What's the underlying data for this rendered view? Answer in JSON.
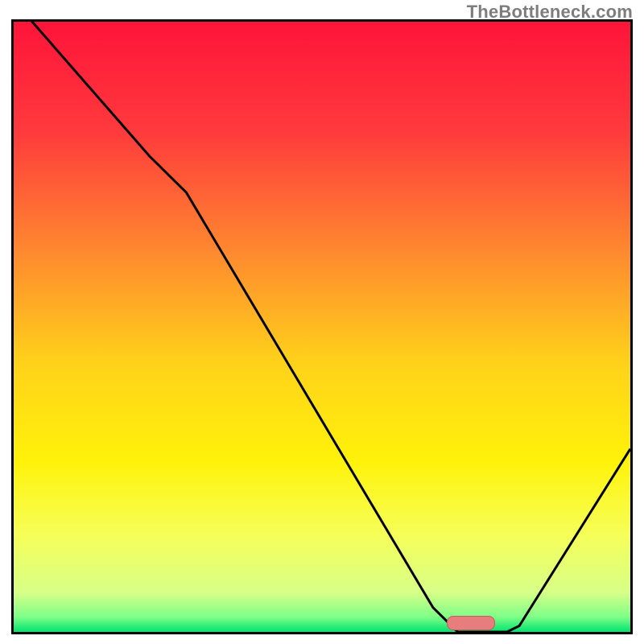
{
  "watermark": "TheBottleneck.com",
  "colors": {
    "gradient_stops": [
      {
        "offset": 0,
        "color": "#ff143a"
      },
      {
        "offset": 0.18,
        "color": "#ff3a3c"
      },
      {
        "offset": 0.38,
        "color": "#ff8a2f"
      },
      {
        "offset": 0.56,
        "color": "#ffd21a"
      },
      {
        "offset": 0.72,
        "color": "#fff20a"
      },
      {
        "offset": 0.84,
        "color": "#f6ff58"
      },
      {
        "offset": 0.935,
        "color": "#d8ff88"
      },
      {
        "offset": 0.975,
        "color": "#7fff88"
      },
      {
        "offset": 1.0,
        "color": "#00e46f"
      }
    ],
    "curve": "#000000",
    "marker_fill": "#e77d7d",
    "marker_stroke": "#c85a5a"
  },
  "chart_data": {
    "type": "line",
    "title": "",
    "xlabel": "",
    "ylabel": "",
    "xlim": [
      0,
      100
    ],
    "ylim": [
      0,
      100
    ],
    "x": [
      0,
      3,
      22,
      28,
      68,
      72,
      80,
      82,
      100
    ],
    "values": [
      110,
      100,
      78,
      72,
      4,
      0,
      0,
      1,
      30
    ],
    "marker": {
      "x": 74,
      "y": 0.7,
      "width_pct": 7.5
    }
  }
}
